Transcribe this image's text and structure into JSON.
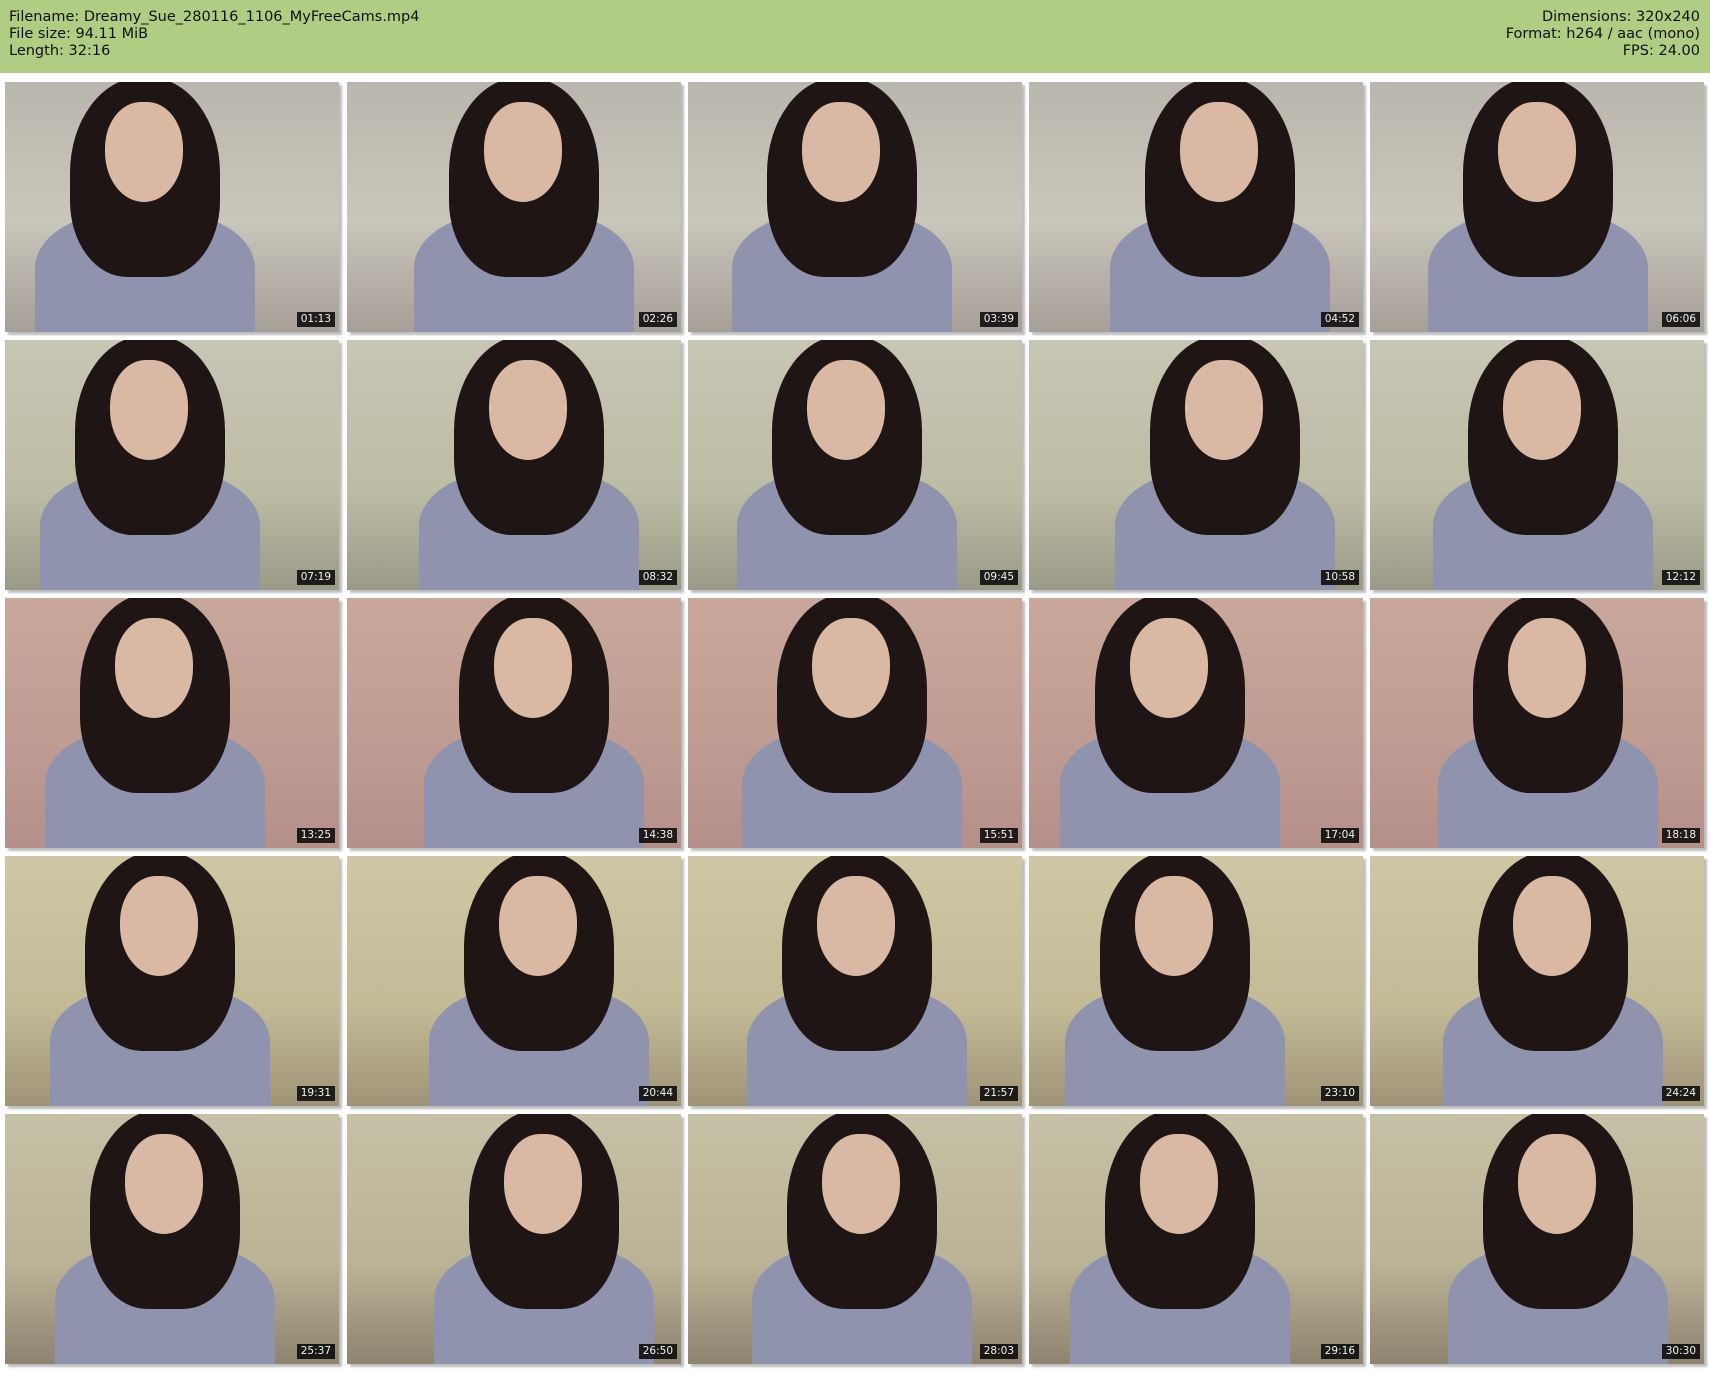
{
  "header": {
    "filename": "Filename: Dreamy_Sue_280116_1106_MyFreeCams.mp4",
    "filesize": "File size: 94.11 MiB",
    "length": "Length: 32:16",
    "dimensions": "Dimensions: 320x240",
    "format": "Format: h264 / aac (mono)",
    "fps": "FPS: 24.00"
  },
  "colors": {
    "header_bg": "#b1cd83",
    "timestamp_bg": "#000000",
    "timestamp_fg": "#f2f2f2"
  },
  "thumbnails": [
    {
      "timestamp": "01:13"
    },
    {
      "timestamp": "02:26"
    },
    {
      "timestamp": "03:39"
    },
    {
      "timestamp": "04:52"
    },
    {
      "timestamp": "06:06"
    },
    {
      "timestamp": "07:19"
    },
    {
      "timestamp": "08:32"
    },
    {
      "timestamp": "09:45"
    },
    {
      "timestamp": "10:58"
    },
    {
      "timestamp": "12:12"
    },
    {
      "timestamp": "13:25"
    },
    {
      "timestamp": "14:38"
    },
    {
      "timestamp": "15:51"
    },
    {
      "timestamp": "17:04"
    },
    {
      "timestamp": "18:18"
    },
    {
      "timestamp": "19:31"
    },
    {
      "timestamp": "20:44"
    },
    {
      "timestamp": "21:57"
    },
    {
      "timestamp": "23:10"
    },
    {
      "timestamp": "24:24"
    },
    {
      "timestamp": "25:37"
    },
    {
      "timestamp": "26:50"
    },
    {
      "timestamp": "28:03"
    },
    {
      "timestamp": "29:16"
    },
    {
      "timestamp": "30:30"
    }
  ]
}
